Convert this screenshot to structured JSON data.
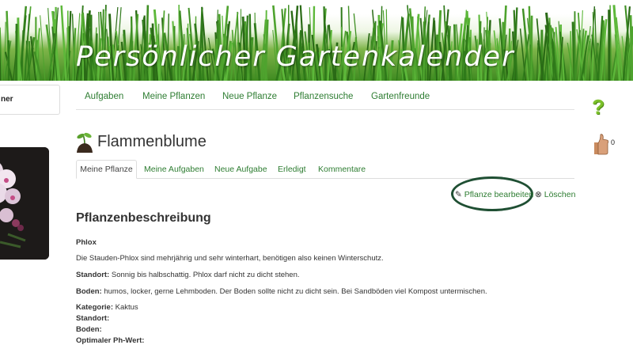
{
  "header": {
    "title": "Persönlicher Gartenkalender"
  },
  "sidebar": {
    "box_label": "ner"
  },
  "nav": {
    "items": [
      {
        "label": "Aufgaben"
      },
      {
        "label": "Meine Pflanzen"
      },
      {
        "label": "Neue Pflanze"
      },
      {
        "label": "Pflanzensuche"
      },
      {
        "label": "Gartenfreunde"
      }
    ]
  },
  "plant": {
    "title": "Flammenblume"
  },
  "tabs": [
    {
      "label": "Meine Pflanze",
      "active": true
    },
    {
      "label": "Meine Aufgaben"
    },
    {
      "label": "Neue Aufgabe"
    },
    {
      "label": "Erledigt"
    },
    {
      "label": "Kommentare"
    }
  ],
  "actions": {
    "edit": "Pflanze bearbeiten",
    "delete": "Löschen"
  },
  "description": {
    "heading": "Pflanzenbeschreibung",
    "name": "Phlox",
    "text": "Die Stauden-Phlox sind mehrjährig und sehr winterhart, benötigen also keinen Winterschutz.",
    "standort_label": "Standort:",
    "standort_text": "Sonnig bis halbschattig. Phlox darf nicht zu dicht stehen.",
    "boden_label": "Boden:",
    "boden_text": "humos, locker, gerne Lehmboden. Der Boden sollte nicht zu dicht sein. Bei Sandböden viel Kompost untermischen.",
    "kategorie_label": "Kategorie:",
    "kategorie_value": "Kaktus",
    "standort2_label": "Standort:",
    "boden2_label": "Boden:",
    "ph_label": "Optimaler Ph-Wert:"
  },
  "widgets": {
    "help_symbol": "?",
    "like_count": "0"
  },
  "icons": {
    "help": "question-mark-icon",
    "like": "thumbs-up-icon",
    "edit": "pencil-icon",
    "delete": "close-circle-icon",
    "plant": "seedling-icon"
  },
  "colors": {
    "link": "#2e7d32",
    "ring": "#1f4f33",
    "help": "#7cc12a"
  }
}
